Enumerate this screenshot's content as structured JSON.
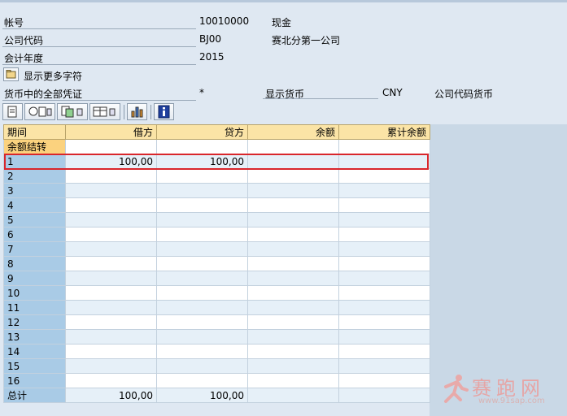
{
  "header": {
    "account_label": "帐号",
    "account_value": "10010000",
    "account_desc": "现金",
    "company_label": "公司代码",
    "company_value": "BJ00",
    "company_desc": "赛北分第一公司",
    "year_label": "会计年度",
    "year_value": "2015"
  },
  "more_chars_label": "显示更多字符",
  "currency_row": {
    "all_docs_label": "货币中的全部凭证",
    "all_docs_value": "*",
    "display_currency_label": "显示货币",
    "display_currency_value": "CNY",
    "company_currency_label": "公司代码货币"
  },
  "toolbar": {
    "icons": [
      "document-icon",
      "detail-view-icon",
      "copy-icon",
      "layout-icon",
      "chart-icon",
      "info-icon"
    ]
  },
  "table": {
    "columns": [
      "期间",
      "借方",
      "贷方",
      "余额",
      "累计余额"
    ],
    "carry_forward_label": "余额结转",
    "rows": [
      {
        "period": "1",
        "debit": "100,00",
        "credit": "100,00",
        "balance": "",
        "cumulative": ""
      },
      {
        "period": "2",
        "debit": "",
        "credit": "",
        "balance": "",
        "cumulative": ""
      },
      {
        "period": "3",
        "debit": "",
        "credit": "",
        "balance": "",
        "cumulative": ""
      },
      {
        "period": "4",
        "debit": "",
        "credit": "",
        "balance": "",
        "cumulative": ""
      },
      {
        "period": "5",
        "debit": "",
        "credit": "",
        "balance": "",
        "cumulative": ""
      },
      {
        "period": "6",
        "debit": "",
        "credit": "",
        "balance": "",
        "cumulative": ""
      },
      {
        "period": "7",
        "debit": "",
        "credit": "",
        "balance": "",
        "cumulative": ""
      },
      {
        "period": "8",
        "debit": "",
        "credit": "",
        "balance": "",
        "cumulative": ""
      },
      {
        "period": "9",
        "debit": "",
        "credit": "",
        "balance": "",
        "cumulative": ""
      },
      {
        "period": "10",
        "debit": "",
        "credit": "",
        "balance": "",
        "cumulative": ""
      },
      {
        "period": "11",
        "debit": "",
        "credit": "",
        "balance": "",
        "cumulative": ""
      },
      {
        "period": "12",
        "debit": "",
        "credit": "",
        "balance": "",
        "cumulative": ""
      },
      {
        "period": "13",
        "debit": "",
        "credit": "",
        "balance": "",
        "cumulative": ""
      },
      {
        "period": "14",
        "debit": "",
        "credit": "",
        "balance": "",
        "cumulative": ""
      },
      {
        "period": "15",
        "debit": "",
        "credit": "",
        "balance": "",
        "cumulative": ""
      },
      {
        "period": "16",
        "debit": "",
        "credit": "",
        "balance": "",
        "cumulative": ""
      }
    ],
    "total": {
      "period": "总计",
      "debit": "100,00",
      "credit": "100,00",
      "balance": "",
      "cumulative": ""
    }
  },
  "watermark": {
    "text": "赛跑网",
    "url": "www.91sap.com"
  },
  "colors": {
    "header_fill": "#fbe4a6",
    "period_fill": "#a9cbe6",
    "carry_fill": "#fbd27e",
    "highlight": "#d9262b"
  }
}
